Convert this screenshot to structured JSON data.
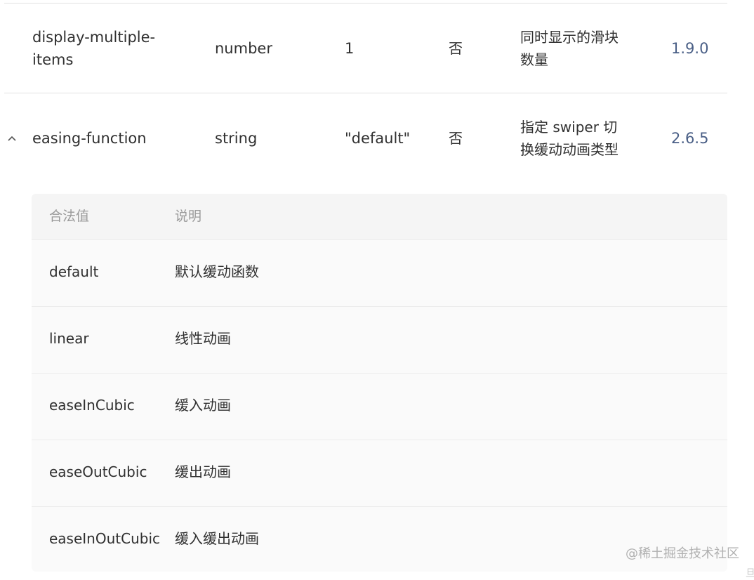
{
  "rows": [
    {
      "name_line1": "display-multiple-",
      "name_line2": "items",
      "type": "number",
      "default": "1",
      "required": "否",
      "desc_line1": "同时显示的滑块",
      "desc_line2": "数量",
      "version": "1.9.0"
    },
    {
      "name": "easing-function",
      "type": "string",
      "default": "\"default\"",
      "required": "否",
      "desc_line1": "指定 swiper 切",
      "desc_line2": "换缓动动画类型",
      "version": "2.6.5"
    }
  ],
  "subtable": {
    "headers": [
      "合法值",
      "说明"
    ],
    "items": [
      {
        "value": "default",
        "desc": "默认缓动函数"
      },
      {
        "value": "linear",
        "desc": "线性动画"
      },
      {
        "value": "easeInCubic",
        "desc": "缓入动画"
      },
      {
        "value": "easeOutCubic",
        "desc": "缓出动画"
      },
      {
        "value": "easeInOutCubic",
        "desc": "缓入缓出动画"
      }
    ]
  },
  "icons": {
    "expand": "chevron-up-icon"
  },
  "watermark": "@稀土掘金技术社区",
  "corner_glyph": "旦",
  "colors": {
    "version_link": "#4a5f86",
    "divider": "#e2e2e2",
    "subtable_bg": "#fafafa"
  }
}
